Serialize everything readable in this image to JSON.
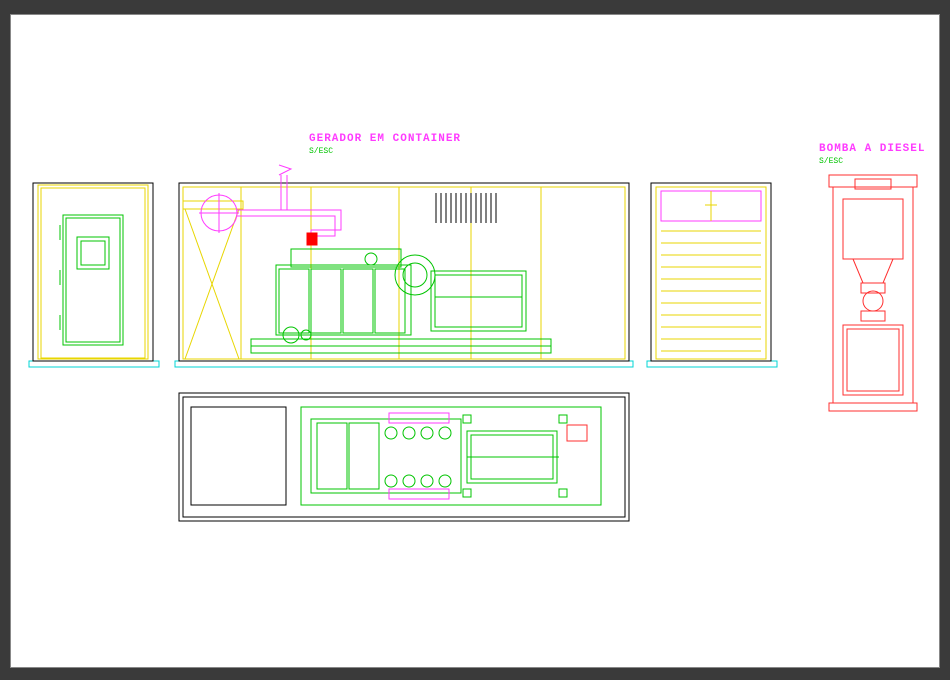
{
  "titles": {
    "generator": "GERADOR EM CONTAINER",
    "generator_sub": "S/ESC",
    "pump": "BOMBA A DIESEL",
    "pump_sub": "S/ESC"
  },
  "colors": {
    "magenta": "#ff3bff",
    "green": "#00c400",
    "yellow": "#e8d600",
    "red": "#ff2f2f",
    "cyan": "#00d4d4",
    "black": "#000000",
    "redfill": "#ff0000"
  },
  "icon_names": {
    "left_end": "container-end-left",
    "side_elev": "container-side-elevation",
    "right_end": "container-end-right",
    "plan": "container-plan-view",
    "pump": "diesel-pump"
  }
}
